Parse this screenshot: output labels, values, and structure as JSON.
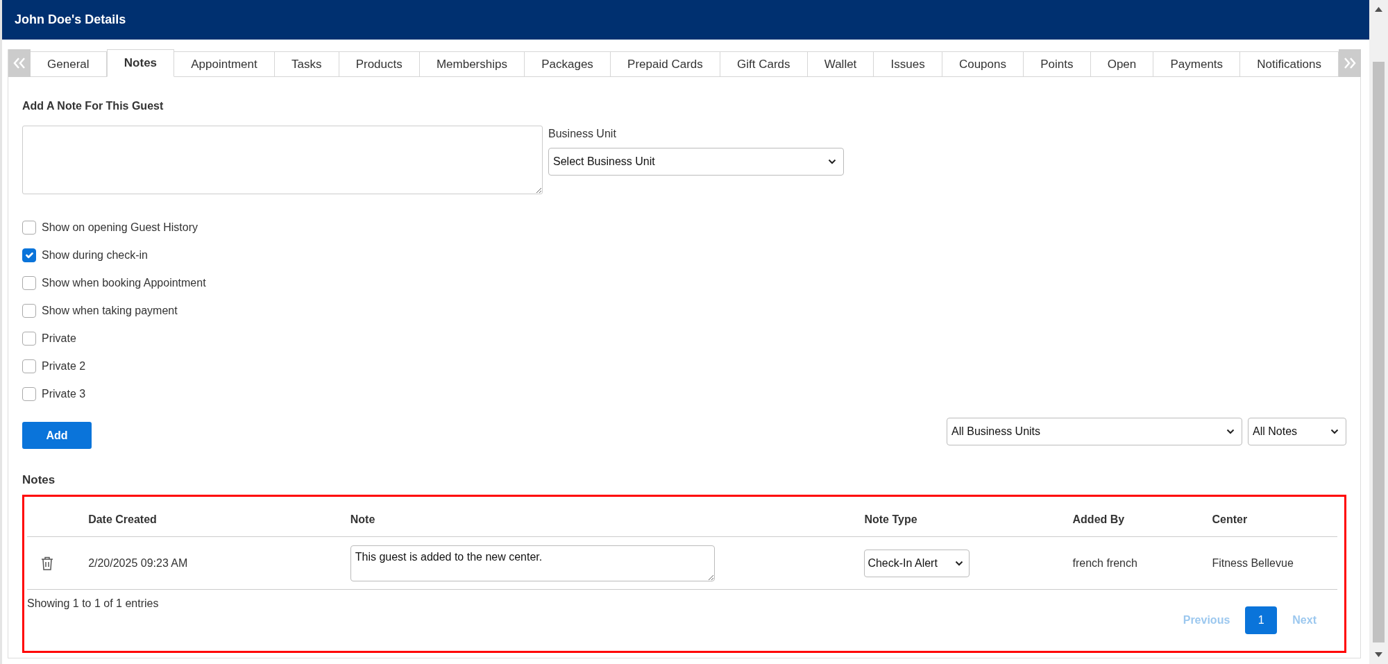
{
  "window": {
    "title": "John Doe's Details"
  },
  "tabs": [
    {
      "label": "General",
      "selected": false
    },
    {
      "label": "Notes",
      "selected": true
    },
    {
      "label": "Appointment",
      "selected": false
    },
    {
      "label": "Tasks",
      "selected": false
    },
    {
      "label": "Products",
      "selected": false
    },
    {
      "label": "Memberships",
      "selected": false
    },
    {
      "label": "Packages",
      "selected": false
    },
    {
      "label": "Prepaid Cards",
      "selected": false
    },
    {
      "label": "Gift Cards",
      "selected": false
    },
    {
      "label": "Wallet",
      "selected": false
    },
    {
      "label": "Issues",
      "selected": false
    },
    {
      "label": "Coupons",
      "selected": false
    },
    {
      "label": "Points",
      "selected": false
    },
    {
      "label": "Open",
      "selected": false
    },
    {
      "label": "Payments",
      "selected": false
    },
    {
      "label": "Notifications",
      "selected": false
    }
  ],
  "note_form": {
    "heading": "Add A Note For This Guest",
    "business_unit_label": "Business Unit",
    "business_unit_select": "Select Business Unit",
    "options": [
      {
        "label": "Show on opening Guest History",
        "checked": false
      },
      {
        "label": "Show during check-in",
        "checked": true
      },
      {
        "label": "Show when booking Appointment",
        "checked": false
      },
      {
        "label": "Show when taking payment",
        "checked": false
      },
      {
        "label": "Private",
        "checked": false
      },
      {
        "label": "Private 2",
        "checked": false
      },
      {
        "label": "Private 3",
        "checked": false
      }
    ],
    "add_button": "Add"
  },
  "filters": [
    {
      "value": "All Business Units"
    },
    {
      "value": "All Notes"
    }
  ],
  "notes": {
    "heading": "Notes",
    "highlighted": true,
    "columns": [
      "Date Created",
      "Note",
      "Note Type",
      "Added By",
      "Center"
    ],
    "rows": [
      {
        "date_created": "2/20/2025 09:23 AM",
        "note": "This guest is added to the new center.",
        "note_type": "Check-In Alert",
        "added_by": "french french",
        "center": "Fitness Bellevue"
      }
    ],
    "summary": "Showing 1 to 1 of 1 entries",
    "pagination": {
      "previous": {
        "label": "Previous",
        "disabled": true
      },
      "pages": [
        {
          "label": "1",
          "selected": true
        }
      ],
      "next": {
        "label": "Next",
        "disabled": true
      }
    }
  }
}
